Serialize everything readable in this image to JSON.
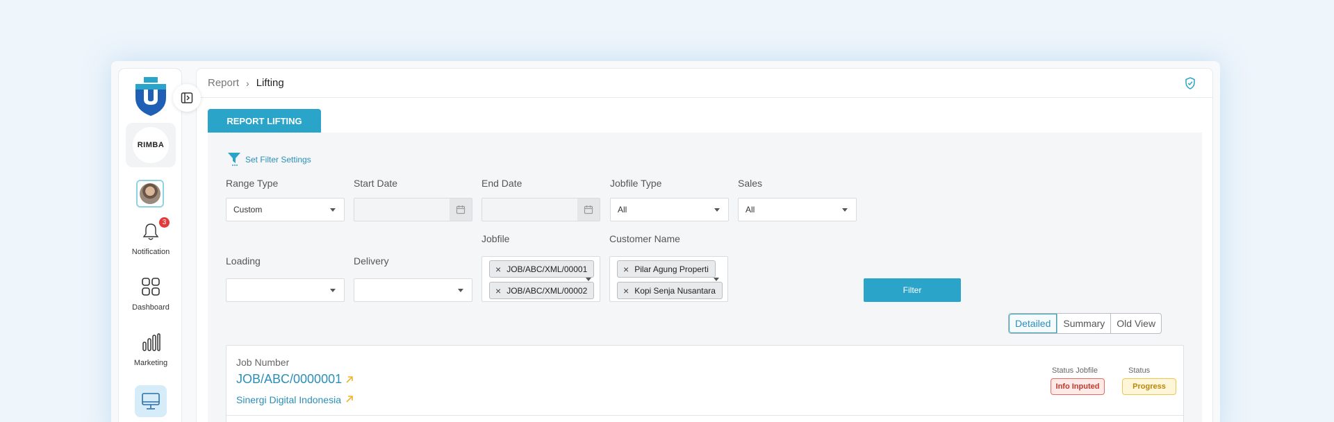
{
  "breadcrumb": {
    "parent": "Report",
    "separator": "›",
    "current": "Lifting"
  },
  "sidebar": {
    "company_logo_text": "RIMBA",
    "notification_count": "3",
    "items": [
      {
        "label": "Notification",
        "icon": "bell-icon"
      },
      {
        "label": "Dashboard",
        "icon": "grid-icon"
      },
      {
        "label": "Marketing",
        "icon": "bar-chart-icon"
      },
      {
        "label": "",
        "icon": "monitor-icon"
      }
    ]
  },
  "tab": {
    "label": "REPORT LIFTING"
  },
  "filter": {
    "heading": "Set Filter Settings",
    "range_type": {
      "label": "Range Type",
      "value": "Custom"
    },
    "start_date": {
      "label": "Start Date",
      "value": ""
    },
    "end_date": {
      "label": "End Date",
      "value": ""
    },
    "jobfile_type": {
      "label": "Jobfile Type",
      "value": "All"
    },
    "sales": {
      "label": "Sales",
      "value": "All"
    },
    "loading": {
      "label": "Loading",
      "value": ""
    },
    "delivery": {
      "label": "Delivery",
      "value": ""
    },
    "jobfile": {
      "label": "Jobfile",
      "chips": [
        "JOB/ABC/XML/00001",
        "JOB/ABC/XML/00002"
      ]
    },
    "customer_name": {
      "label": "Customer Name",
      "chips": [
        "Pilar Agung Properti",
        "Kopi Senja Nusantara"
      ]
    },
    "button_label": "Filter"
  },
  "view_toggle": {
    "options": [
      "Detailed",
      "Summary",
      "Old View"
    ],
    "selected": "Detailed"
  },
  "job": {
    "label": "Job Number",
    "number": "JOB/ABC/0000001",
    "customer": "Sinergi Digital Indonesia",
    "status_jobfile_label": "Status Jobfile",
    "status_jobfile": "Info Inputed",
    "status_label": "Status",
    "status": "Progress"
  },
  "colors": {
    "accent": "#2aa4c8",
    "link": "#2a8fb8",
    "danger": "#e56a5b",
    "warning": "#f0c64a"
  }
}
